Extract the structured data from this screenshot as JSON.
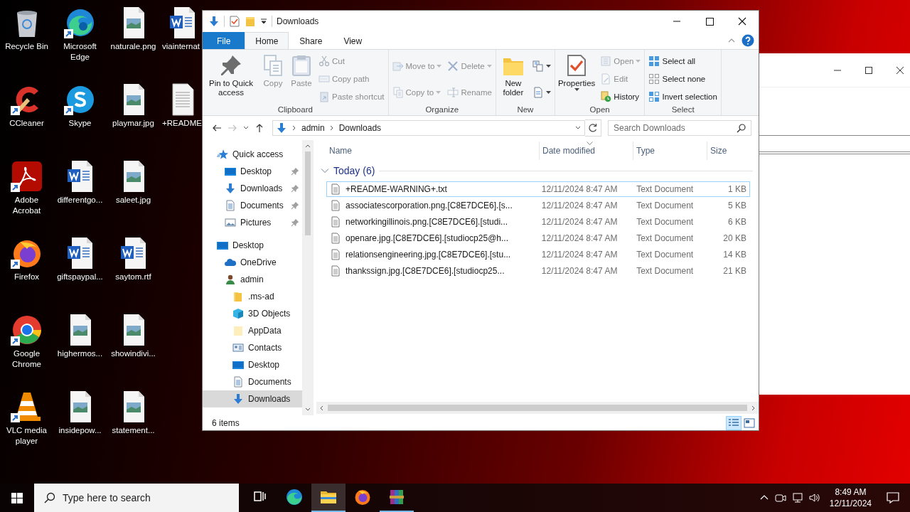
{
  "desktop": {
    "columns": [
      [
        {
          "label": "Recycle Bin",
          "kind": "recycle",
          "shortcut": false
        },
        {
          "label": "CCleaner",
          "kind": "ccleaner",
          "shortcut": true
        },
        {
          "label": "Adobe Acrobat",
          "kind": "acrobat",
          "shortcut": true
        },
        {
          "label": "Firefox",
          "kind": "firefox",
          "shortcut": true
        },
        {
          "label": "Google Chrome",
          "kind": "chrome",
          "shortcut": true
        },
        {
          "label": "VLC media player",
          "kind": "vlc",
          "shortcut": true
        }
      ],
      [
        {
          "label": "Microsoft Edge",
          "kind": "edge",
          "shortcut": true
        },
        {
          "label": "Skype",
          "kind": "skype",
          "shortcut": true
        },
        {
          "label": "differentgo...",
          "kind": "word",
          "shortcut": false
        },
        {
          "label": "giftspaypal...",
          "kind": "word",
          "shortcut": false
        },
        {
          "label": "highermos...",
          "kind": "image",
          "shortcut": false
        },
        {
          "label": "insidepow...",
          "kind": "image",
          "shortcut": false
        }
      ],
      [
        {
          "label": "naturale.png",
          "kind": "image",
          "shortcut": false
        },
        {
          "label": "playmar.jpg",
          "kind": "image",
          "shortcut": false
        },
        {
          "label": "saleet.jpg",
          "kind": "image",
          "shortcut": false
        },
        {
          "label": "saytom.rtf",
          "kind": "word",
          "shortcut": false
        },
        {
          "label": "showindivi...",
          "kind": "image",
          "shortcut": false
        },
        {
          "label": "statement...",
          "kind": "image",
          "shortcut": false
        }
      ],
      [
        {
          "label": "viainternat",
          "kind": "word",
          "shortcut": false
        },
        {
          "label": "+README",
          "kind": "text",
          "shortcut": false
        }
      ]
    ]
  },
  "explorer": {
    "title": "Downloads",
    "ribbon_tabs": [
      {
        "label": "File",
        "kind": "file",
        "selected": false
      },
      {
        "label": "Home",
        "kind": "tab",
        "selected": true
      },
      {
        "label": "Share",
        "kind": "tab",
        "selected": false
      },
      {
        "label": "View",
        "kind": "tab",
        "selected": false
      }
    ],
    "ribbon_groups": [
      {
        "label": "Clipboard",
        "columns": [
          {
            "kind": "large",
            "items": [
              {
                "label": "Pin to Quick access",
                "kind": "pin",
                "disabled": false,
                "dropdown": false
              }
            ]
          },
          {
            "kind": "large",
            "items": [
              {
                "label": "Copy",
                "kind": "copy",
                "disabled": true,
                "dropdown": false
              }
            ]
          },
          {
            "kind": "large",
            "items": [
              {
                "label": "Paste",
                "kind": "paste",
                "disabled": true,
                "dropdown": false
              }
            ]
          },
          {
            "kind": "small",
            "items": [
              {
                "label": "Cut",
                "kind": "cut",
                "disabled": true,
                "dropdown": false
              },
              {
                "label": "Copy path",
                "kind": "copy-path",
                "disabled": true,
                "dropdown": false
              },
              {
                "label": "Paste shortcut",
                "kind": "paste-shortcut",
                "disabled": true,
                "dropdown": false
              }
            ]
          }
        ]
      },
      {
        "label": "Organize",
        "columns": [
          {
            "kind": "small",
            "items": [
              {
                "label": "Move to",
                "kind": "move-to",
                "disabled": true,
                "dropdown": true
              },
              {
                "label": "Copy to",
                "kind": "copy-to",
                "disabled": true,
                "dropdown": true
              }
            ]
          },
          {
            "kind": "small",
            "items": [
              {
                "label": "Delete",
                "kind": "delete",
                "disabled": true,
                "dropdown": true
              },
              {
                "label": "Rename",
                "kind": "rename",
                "disabled": true,
                "dropdown": false
              }
            ]
          }
        ]
      },
      {
        "label": "New",
        "columns": [
          {
            "kind": "large",
            "items": [
              {
                "label": "New folder",
                "kind": "new-folder",
                "disabled": false,
                "dropdown": false
              }
            ]
          },
          {
            "kind": "small",
            "items": [
              {
                "kind": "new-item",
                "disabled": false,
                "dropdown": true
              },
              {
                "kind": "easy-access",
                "disabled": false,
                "dropdown": true
              }
            ]
          }
        ]
      },
      {
        "label": "Open",
        "columns": [
          {
            "kind": "large",
            "items": [
              {
                "label": "Properties",
                "kind": "properties",
                "disabled": false,
                "dropdown": true
              }
            ]
          },
          {
            "kind": "small",
            "items": [
              {
                "label": "Open",
                "kind": "open",
                "disabled": true,
                "dropdown": true
              },
              {
                "label": "Edit",
                "kind": "edit",
                "disabled": true,
                "dropdown": false
              },
              {
                "label": "History",
                "kind": "history",
                "disabled": false,
                "dropdown": false
              }
            ]
          }
        ]
      },
      {
        "label": "Select",
        "columns": [
          {
            "kind": "small",
            "items": [
              {
                "label": "Select all",
                "kind": "select-all",
                "disabled": false,
                "dropdown": false
              },
              {
                "label": "Select none",
                "kind": "select-none",
                "disabled": false,
                "dropdown": false
              },
              {
                "label": "Invert selection",
                "kind": "invert-selection",
                "disabled": false,
                "dropdown": false
              }
            ]
          }
        ]
      }
    ],
    "address_path": [
      "admin",
      "Downloads"
    ],
    "search_placeholder": "Search Downloads",
    "nav_tree": [
      {
        "label": "Quick access",
        "kind": "star",
        "selected": false,
        "children": [
          {
            "label": "Desktop",
            "kind": "desktop",
            "selected": false,
            "pinned": true
          },
          {
            "label": "Downloads",
            "kind": "downloads",
            "selected": false,
            "pinned": true
          },
          {
            "label": "Documents",
            "kind": "documents",
            "selected": false,
            "pinned": true
          },
          {
            "label": "Pictures",
            "kind": "pictures",
            "selected": false,
            "pinned": true
          }
        ]
      },
      {
        "label": "Desktop",
        "kind": "desktop",
        "selected": false,
        "children": [
          {
            "label": "OneDrive",
            "kind": "cloud",
            "selected": false
          },
          {
            "label": "admin",
            "kind": "user",
            "selected": false,
            "children": [
              {
                "label": ".ms-ad",
                "kind": "folder",
                "selected": false
              },
              {
                "label": "3D Objects",
                "kind": "cube",
                "selected": false
              },
              {
                "label": "AppData",
                "kind": "folder-light",
                "selected": false
              },
              {
                "label": "Contacts",
                "kind": "contacts",
                "selected": false
              },
              {
                "label": "Desktop",
                "kind": "desktop",
                "selected": false
              },
              {
                "label": "Documents",
                "kind": "documents",
                "selected": false
              },
              {
                "label": "Downloads",
                "kind": "downloads",
                "selected": true
              }
            ]
          }
        ]
      }
    ],
    "columns": [
      {
        "label": "Name",
        "sorted": false
      },
      {
        "label": "Date modified",
        "sorted": true
      },
      {
        "label": "Type",
        "sorted": false
      },
      {
        "label": "Size",
        "sorted": false
      }
    ],
    "group": {
      "label": "Today (6)",
      "expanded": true
    },
    "files": [
      {
        "name": "+README-WARNING+.txt",
        "date": "12/11/2024 8:47 AM",
        "type": "Text Document",
        "size": "1 KB",
        "focused": true
      },
      {
        "name": "associatescorporation.png.[C8E7DCE6].[s...",
        "date": "12/11/2024 8:47 AM",
        "type": "Text Document",
        "size": "5 KB",
        "focused": false
      },
      {
        "name": "networkingillinois.png.[C8E7DCE6].[studi...",
        "date": "12/11/2024 8:47 AM",
        "type": "Text Document",
        "size": "6 KB",
        "focused": false
      },
      {
        "name": "openare.jpg.[C8E7DCE6].[studiocp25@h...",
        "date": "12/11/2024 8:47 AM",
        "type": "Text Document",
        "size": "20 KB",
        "focused": false
      },
      {
        "name": "relationsengineering.jpg.[C8E7DCE6].[stu...",
        "date": "12/11/2024 8:47 AM",
        "type": "Text Document",
        "size": "14 KB",
        "focused": false
      },
      {
        "name": "thankssign.jpg.[C8E7DCE6].[studiocp25...",
        "date": "12/11/2024 8:47 AM",
        "type": "Text Document",
        "size": "21 KB",
        "focused": false
      }
    ],
    "status": "6 items",
    "views": [
      {
        "kind": "details",
        "selected": true
      },
      {
        "kind": "tiles",
        "selected": false
      }
    ]
  },
  "taskbar": {
    "search_placeholder": "Type here to search",
    "apps": [
      {
        "kind": "taskview",
        "active": false,
        "running": false
      },
      {
        "kind": "edge",
        "active": false,
        "running": false
      },
      {
        "kind": "explorer",
        "active": true,
        "running": true
      },
      {
        "kind": "firefox",
        "active": false,
        "running": false
      },
      {
        "kind": "winrar",
        "active": false,
        "running": true
      }
    ],
    "time": "8:49 AM",
    "date": "12/11/2024"
  }
}
